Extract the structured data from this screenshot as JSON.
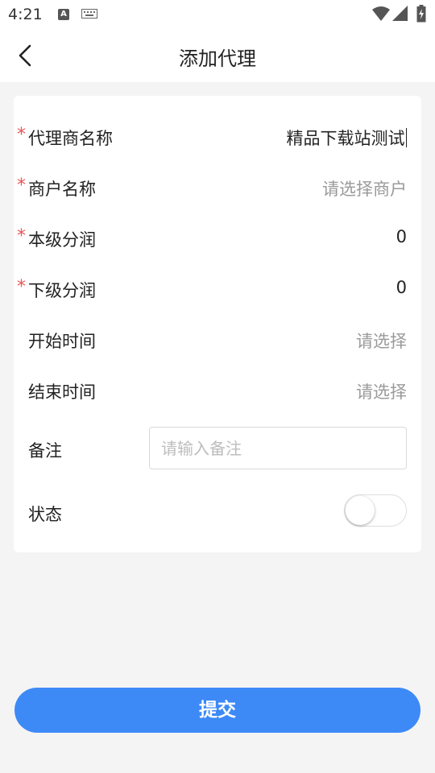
{
  "status_bar": {
    "time": "4:21",
    "a_badge": "A",
    "icons": [
      "a-notification-icon",
      "keyboard-icon",
      "wifi-icon",
      "signal-icon",
      "battery-icon"
    ]
  },
  "header": {
    "title": "添加代理",
    "back_icon": "chevron-left-icon"
  },
  "form": {
    "required_mark": "*",
    "agent_name": {
      "label": "代理商名称",
      "value": "精品下载站测试",
      "required": true
    },
    "merchant_name": {
      "label": "商户名称",
      "placeholder": "请选择商户",
      "required": true
    },
    "this_level_share": {
      "label": "本级分润",
      "value": "0",
      "required": true
    },
    "next_level_share": {
      "label": "下级分润",
      "value": "0",
      "required": true
    },
    "start_time": {
      "label": "开始时间",
      "placeholder": "请选择",
      "required": false
    },
    "end_time": {
      "label": "结束时间",
      "placeholder": "请选择",
      "required": false
    },
    "remark": {
      "label": "备注",
      "placeholder": "请输入备注",
      "value": ""
    },
    "status": {
      "label": "状态",
      "enabled": false
    }
  },
  "submit": {
    "label": "提交"
  },
  "colors": {
    "primary": "#3d8af7",
    "required": "#e95555",
    "background": "#f4f4f4",
    "card": "#ffffff",
    "placeholder": "#9a9a9a"
  }
}
